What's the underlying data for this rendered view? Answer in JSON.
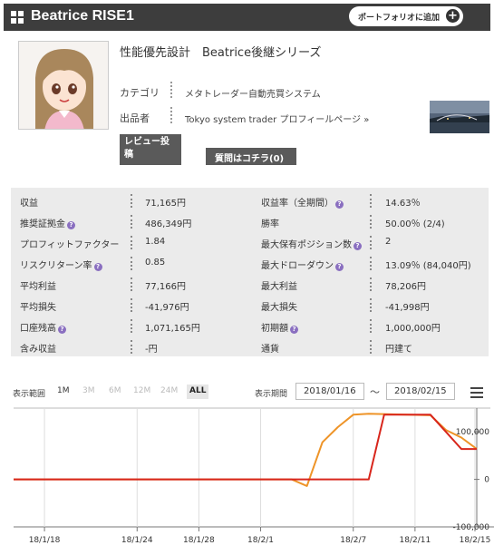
{
  "header": {
    "title": "Beatrice RISE1",
    "portfolio_button": "ポートフォリオに追加",
    "plus_glyph": "+"
  },
  "product": {
    "name": "性能優先設計　Beatrice後継シリーズ",
    "category_label": "カテゴリ",
    "category_value": "メタトレーダー自動売買システム",
    "seller_label": "出品者",
    "seller_value": "Tokyo system trader プロフィールページ »",
    "review_button": "レビュー投稿",
    "question_button": "質問はコチラ(0)"
  },
  "stats": {
    "help_glyph": "?",
    "rows": [
      {
        "l1": "収益",
        "v1": "71,165円",
        "l2": "収益率（全期間）",
        "v2": "14.63％"
      },
      {
        "l1": "推奨証拠金",
        "v1": "486,349円",
        "l2": "勝率",
        "v2": "50.00％ (2/4)"
      },
      {
        "l1": "プロフィットファクター",
        "v1": "1.84",
        "l2": "最大保有ポジション数",
        "v2": "2"
      },
      {
        "l1": "リスクリターン率",
        "v1": "0.85",
        "l2": "最大ドローダウン",
        "v2": "13.09％ (84,040円)"
      },
      {
        "l1": "平均利益",
        "v1": "77,166円",
        "l2": "最大利益",
        "v2": "78,206円"
      },
      {
        "l1": "平均損失",
        "v1": "-41,976円",
        "l2": "最大損失",
        "v2": "-41,998円"
      },
      {
        "l1": "口座残高",
        "v1": "1,071,165円",
        "l2": "初期額",
        "v2": "1,000,000円"
      },
      {
        "l1": "含み収益",
        "v1": "-円",
        "l2": "通貨",
        "v2": "円建て"
      }
    ]
  },
  "controls": {
    "range_label": "表示範囲",
    "ranges": [
      "1M",
      "3M",
      "6M",
      "12M",
      "24M",
      "ALL"
    ],
    "selected_range": "ALL",
    "period_label": "表示期間",
    "date_from": "2018/01/16",
    "tilde": "〜",
    "date_to": "2018/02/15"
  },
  "chart_data": {
    "type": "line",
    "x_tick_labels": [
      "18/1/18",
      "18/1/24",
      "18/1/28",
      "18/2/1",
      "18/2/7",
      "18/2/11",
      "18/2/15"
    ],
    "y_tick_labels": [
      "100,000",
      "0",
      "-100,000"
    ],
    "ylim": [
      -100000,
      150000
    ],
    "colors": {
      "realized": "#d8261c",
      "with_unrealized": "#ee9428",
      "grid": "#dddddd",
      "axis": "#333333"
    },
    "series": [
      {
        "color": "#d8261c",
        "x": [
          "2018/01/16",
          "2018/02/08",
          "2018/02/09",
          "2018/02/12",
          "2018/02/14",
          "2018/02/15"
        ],
        "y": [
          0,
          0,
          136000,
          136000,
          64000,
          64000
        ]
      },
      {
        "color": "#ee9428",
        "x": [
          "2018/01/16",
          "2018/02/03",
          "2018/02/04",
          "2018/02/05",
          "2018/02/06",
          "2018/02/07",
          "2018/02/08",
          "2018/02/12",
          "2018/02/13",
          "2018/02/14",
          "2018/02/15"
        ],
        "y": [
          0,
          0,
          -14000,
          78000,
          110000,
          136000,
          138000,
          135000,
          104000,
          88000,
          64000
        ]
      }
    ]
  }
}
